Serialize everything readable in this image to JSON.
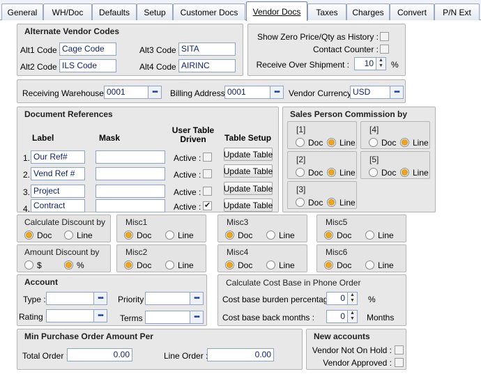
{
  "tabs": [
    "General",
    "WH/Doc",
    "Defaults",
    "Setup",
    "Customer Docs",
    "Vendor Docs",
    "Taxes",
    "Charges",
    "Convert",
    "P/N Ext"
  ],
  "active_tab": "Vendor Docs",
  "alt_codes": {
    "title": "Alternate Vendor Codes",
    "alt1_label": "Alt1 Code :",
    "alt1_value": "Cage Code",
    "alt2_label": "Alt2 Code :",
    "alt2_value": "ILS Code",
    "alt3_label": "Alt3 Code :",
    "alt3_value": "SITA",
    "alt4_label": "Alt4 Code :",
    "alt4_value": "AIRINC"
  },
  "history": {
    "show_zero_label": "Show Zero Price/Qty as History :",
    "show_zero_checked": false,
    "contact_counter_label": "Contact Counter :",
    "contact_counter_checked": false,
    "receive_over_label": "Receive Over Shipment :",
    "receive_over_value": "10",
    "receive_over_unit": "%"
  },
  "warehouse": {
    "receiving_label": "Receiving Warehouse :",
    "receiving_value": "0001",
    "billing_label": "Billing Address :",
    "billing_value": "0001",
    "currency_label": "Vendor Currency :",
    "currency_value": "USD"
  },
  "doc_refs": {
    "title": "Document References",
    "col_label": "Label",
    "col_mask": "Mask",
    "col_user_table": "User Table Driven",
    "col_table_setup": "Table Setup",
    "active_label": "Active :",
    "update_label": "Update Table",
    "rows": [
      {
        "num": "1.",
        "label": "Our Ref#",
        "mask": "",
        "active": false
      },
      {
        "num": "2.",
        "label": "Vend Ref #",
        "mask": "",
        "active": false
      },
      {
        "num": "3.",
        "label": "Project",
        "mask": "",
        "active": false
      },
      {
        "num": "4.",
        "label": "Contract",
        "mask": "",
        "active": true
      }
    ]
  },
  "commission": {
    "title": "Sales Person Commission by",
    "doc_label": "Doc",
    "line_label": "Line",
    "groups": [
      {
        "name": "[1]",
        "selected": "Line"
      },
      {
        "name": "[4]",
        "selected": "Line"
      },
      {
        "name": "[2]",
        "selected": "Line"
      },
      {
        "name": "[5]",
        "selected": "Line"
      },
      {
        "name": "[3]",
        "selected": "Line"
      }
    ]
  },
  "options": {
    "doc_label": "Doc",
    "line_label": "Line",
    "calc_discount": {
      "title": "Calculate Discount by",
      "selected": "Doc"
    },
    "amount_discount": {
      "title": "Amount Discount by",
      "opt1": "$",
      "opt2": "%",
      "selected": "%"
    },
    "misc": [
      {
        "name": "Misc1",
        "selected": "Doc"
      },
      {
        "name": "Misc2",
        "selected": "Doc"
      },
      {
        "name": "Misc3",
        "selected": "Doc"
      },
      {
        "name": "Misc4",
        "selected": "Doc"
      },
      {
        "name": "Misc5",
        "selected": "Doc"
      },
      {
        "name": "Misc6",
        "selected": "Doc"
      }
    ]
  },
  "account": {
    "title": "Account",
    "type_label": "Type :",
    "type_value": "",
    "rating_label": "Rating :",
    "rating_value": "",
    "priority_label": "Priority :",
    "priority_value": "",
    "terms_label": "Terms :",
    "terms_value": ""
  },
  "cost_base": {
    "title": "Calculate Cost Base in Phone Order",
    "burden_label": "Cost base burden percentage :",
    "burden_value": "0",
    "burden_unit": "%",
    "back_months_label": "Cost base back months :",
    "back_months_value": "0",
    "back_months_unit": "Months"
  },
  "min_po": {
    "title": "Min Purchase Order Amount Per",
    "total_label": "Total Order :",
    "total_value": "0.00",
    "line_label": "Line Order :",
    "line_value": "0.00"
  },
  "new_accounts": {
    "title": "New accounts",
    "not_on_hold_label": "Vendor Not On Hold :",
    "not_on_hold_checked": false,
    "approved_label": "Vendor Approved :",
    "approved_checked": false
  }
}
